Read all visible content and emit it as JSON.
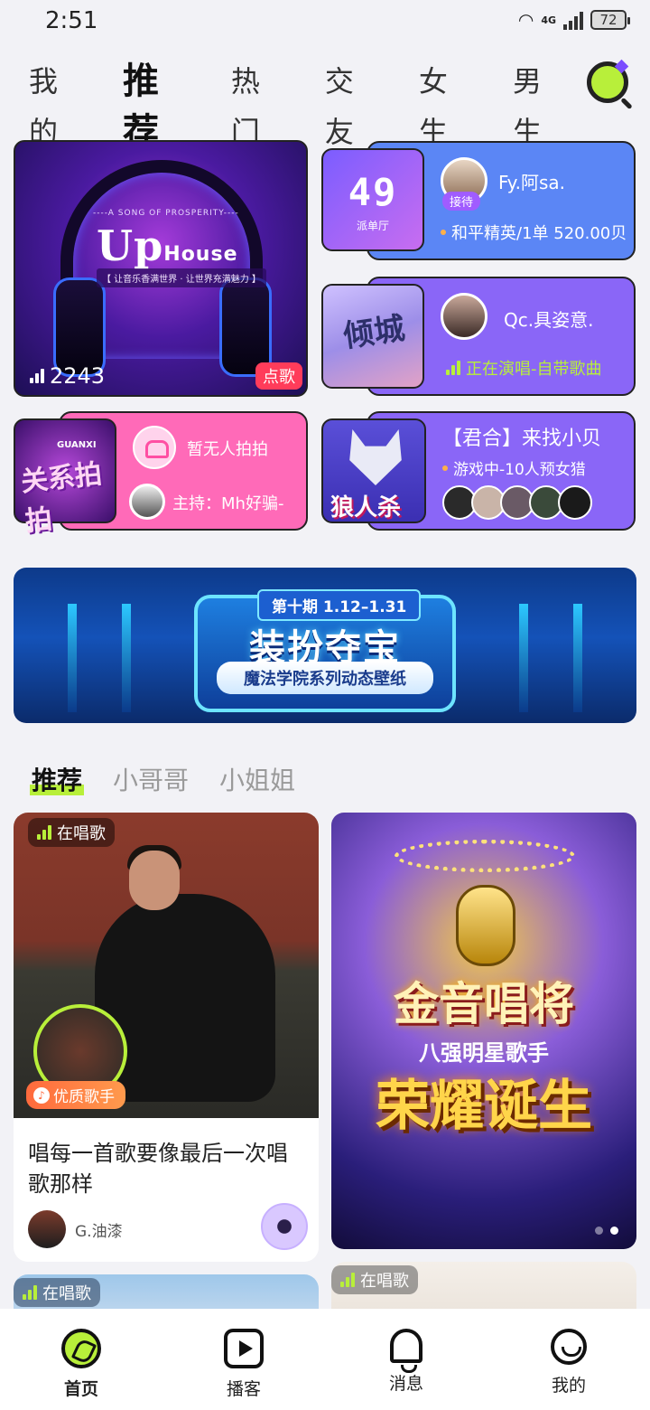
{
  "status_bar": {
    "time": "2:51",
    "network": "4G",
    "battery": "72"
  },
  "top_tabs": [
    {
      "label": "我的",
      "active": false
    },
    {
      "label": "推荐",
      "active": true
    },
    {
      "label": "热门",
      "active": false
    },
    {
      "label": "交友",
      "active": false
    },
    {
      "label": "女生",
      "active": false
    },
    {
      "label": "男生",
      "active": false
    }
  ],
  "rooms": {
    "uphouse": {
      "title_big": "Up",
      "title_small": "House",
      "subtitle": "----A SONG OF PROSPERITY----",
      "slogan": "【 让音乐香满世界 · 让世界充满魅力 】",
      "listeners": "2243",
      "tag": "点歌"
    },
    "dispatch": {
      "number": "49",
      "number_label": "派单厅",
      "host_name": "Fy.阿sa.",
      "host_badge": "接待",
      "status": "和平精英/1单 520.00贝"
    },
    "singing": {
      "cover_text": "倾城",
      "host_name": "Qc.具姿意.",
      "status": "正在演唱-自带歌曲"
    },
    "guanxi": {
      "cover_text": "关系拍拍",
      "cover_brand": "GUANXI",
      "status": "暂无人拍拍",
      "host": "主持：Mh好骗-"
    },
    "werewolf": {
      "cover_text": "狼人杀",
      "title": "【君合】来找小贝",
      "status": "游戏中-10人预女猎"
    }
  },
  "banner": {
    "issue": "第十期  1.12–1.31",
    "title": "装扮夺宝",
    "subtitle": "魔法学院系列动态壁纸"
  },
  "section_tabs": [
    {
      "label": "推荐",
      "active": true
    },
    {
      "label": "小哥哥",
      "active": false
    },
    {
      "label": "小姐姐",
      "active": false
    }
  ],
  "feed": {
    "left": {
      "tag": "在唱歌",
      "badge": "优质歌手",
      "title": "唱每一首歌要像最后一次唱歌那样",
      "author": "G.油漆"
    },
    "right": {
      "main": "金音唱将",
      "sub": "八强明星歌手",
      "big": "荣耀诞生"
    },
    "peek_left_tag": "在唱歌",
    "peek_right_tag": "在唱歌"
  },
  "bottom_nav": [
    {
      "label": "首页",
      "icon": "home-icon",
      "active": true
    },
    {
      "label": "播客",
      "icon": "podcast-play-icon",
      "active": false
    },
    {
      "label": "消息",
      "icon": "bell-icon",
      "active": false
    },
    {
      "label": "我的",
      "icon": "profile-icon",
      "active": false
    }
  ],
  "colors": {
    "accent_green": "#b8ef3a",
    "accent_purple": "#7b4dff",
    "card_blue": "#5b86f5",
    "card_purple": "#8a66f7",
    "card_pink": "#ff6ab8"
  }
}
